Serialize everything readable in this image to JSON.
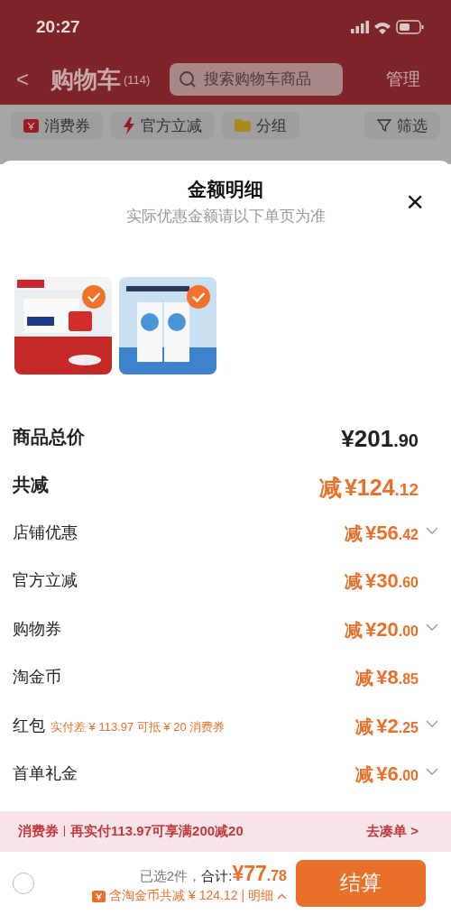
{
  "status_bar": {
    "time": "20:27"
  },
  "header": {
    "back": "<",
    "title": "购物车",
    "count": "(114)",
    "search": {
      "placeholder": "搜索购物车商品"
    },
    "manage": "管理"
  },
  "chips": [
    {
      "kind": "coupon",
      "label": "消费券"
    },
    {
      "kind": "bolt",
      "label": "官方立减"
    },
    {
      "kind": "folder",
      "label": "分组"
    },
    {
      "kind": "filter",
      "label": "筛选"
    }
  ],
  "sheet": {
    "title": "金额明细",
    "subtitle": "实际优惠金额请以下单页为准",
    "close": "×",
    "products": [
      {
        "kind": "masks",
        "checked": true
      },
      {
        "kind": "facemask",
        "checked": true
      }
    ],
    "rows": [
      {
        "kind": "total",
        "label": "商品总价",
        "prefix": "",
        "main": "¥201",
        "cents": ".90",
        "expandable": false
      },
      {
        "kind": "summary",
        "label": "共减",
        "prefix": "减",
        "main": "¥124",
        "cents": ".12",
        "expandable": false
      },
      {
        "kind": "item",
        "label": "店铺优惠",
        "prefix": "减",
        "main": "¥56",
        "cents": ".42",
        "expandable": true
      },
      {
        "kind": "item",
        "label": "官方立减",
        "prefix": "减",
        "main": "¥30",
        "cents": ".60",
        "expandable": false
      },
      {
        "kind": "item",
        "label": "购物券",
        "prefix": "减",
        "main": "¥20",
        "cents": ".00",
        "expandable": true
      },
      {
        "kind": "item",
        "label": "淘金币",
        "prefix": "减",
        "main": "¥8",
        "cents": ".85",
        "expandable": false
      },
      {
        "kind": "item",
        "label": "红包",
        "note": "实付差 ¥ 113.97 可抵 ¥ 20 消费券",
        "prefix": "减",
        "main": "¥2",
        "cents": ".25",
        "expandable": true
      },
      {
        "kind": "item",
        "label": "首单礼金",
        "prefix": "减",
        "main": "¥6",
        "cents": ".00",
        "expandable": true
      }
    ]
  },
  "banner": {
    "tag": "消费券",
    "message": "再实付113.97可享满200减20",
    "link": "去凑单 >"
  },
  "footer": {
    "select_all": {
      "checked": false
    },
    "selected": "已选2件，",
    "total_label": "合计:",
    "total_main": "¥77",
    "total_cents": ".78",
    "savings": "含淘金币共减 ¥ 124.12 | 明细",
    "checkout": "结算"
  }
}
